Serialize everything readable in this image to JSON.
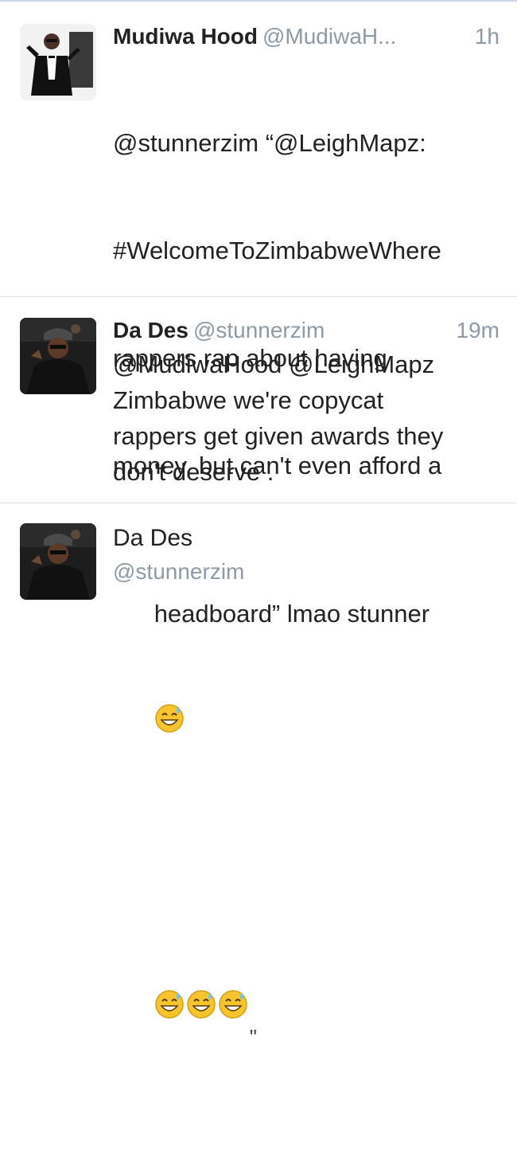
{
  "tweets": [
    {
      "name": "Mudiwa Hood",
      "handle": "@MudiwaH...",
      "time": "1h",
      "avatar_icon": "person-in-tuxedo-avatar",
      "text_line1": "@stunnerzim “@LeighMapz:",
      "text_line2": "#WelcomeToZimbabweWhere",
      "text_line3": "rappers rap about having",
      "text_line4": "money, but can't even afford a",
      "text_line5": "headboard” lmao stunner",
      "text_end_quote": "\""
    },
    {
      "name": "Da Des",
      "handle": "@stunnerzim",
      "time": "19m",
      "avatar_icon": "man-in-cap-avatar",
      "text": "@MudiwaHood @LeighMapz\nZimbabwe we're copycat\nrappers get given awards they\ndon't deserve ."
    }
  ],
  "profile": {
    "name": "Da Des",
    "handle": "@stunnerzim",
    "avatar_icon": "man-in-cap-avatar"
  },
  "emoji_icon": "sweat-smile-emoji"
}
